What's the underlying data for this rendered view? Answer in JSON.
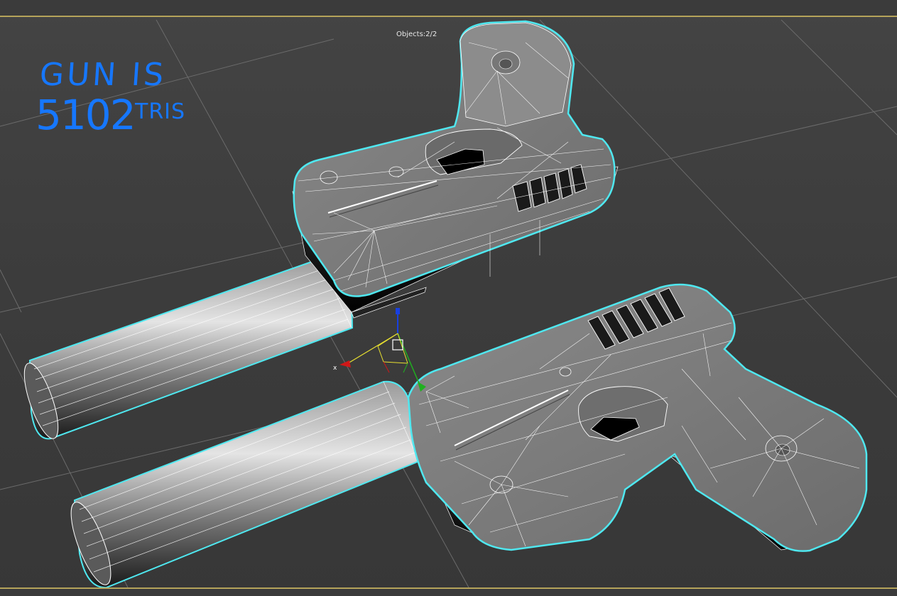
{
  "viewport": {
    "stats": {
      "label": "Objects:",
      "selected": "2",
      "total": "2"
    },
    "annotation": {
      "line1": "GUN IS",
      "count": "5102",
      "unit": "TRIS",
      "color": "#1677ff"
    },
    "colors": {
      "selection_outline": "#4fe8f0",
      "grid_line": "#6a6a6a",
      "wire": "#ffffff",
      "frame_accent": "#b5a35a"
    },
    "gizmo": {
      "x_axis_label": "x",
      "x_color": "#d01818",
      "y_color": "#20b020",
      "z_color": "#1840e0"
    }
  }
}
